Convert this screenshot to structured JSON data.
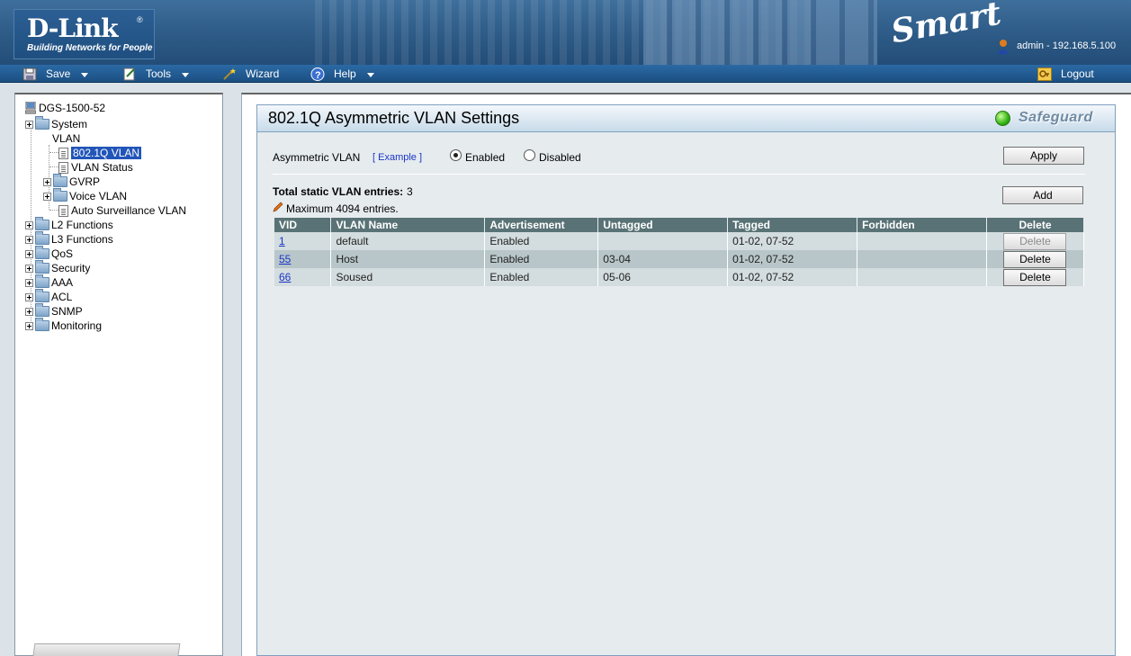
{
  "header": {
    "logo_text": "D-Link",
    "logo_registered": "®",
    "logo_tagline": "Building Networks for People",
    "brand_script": "Smart",
    "user_info": "admin - 192.168.5.100"
  },
  "menubar": {
    "save": "Save",
    "tools": "Tools",
    "wizard": "Wizard",
    "help": "Help",
    "logout": "Logout"
  },
  "tree": {
    "root": "DGS-1500-52",
    "system": "System",
    "vlan": "VLAN",
    "vlan_8021q": "802.1Q VLAN",
    "vlan_status": "VLAN Status",
    "gvrp": "GVRP",
    "voice_vlan": "Voice VLAN",
    "auto_surveillance": "Auto Surveillance VLAN",
    "l2": "L2 Functions",
    "l3": "L3 Functions",
    "qos": "QoS",
    "security": "Security",
    "aaa": "AAA",
    "acl": "ACL",
    "snmp": "SNMP",
    "monitoring": "Monitoring"
  },
  "page": {
    "title": "802.1Q Asymmetric VLAN Settings",
    "safeguard": "Safeguard",
    "asym_label": "Asymmetric VLAN",
    "example_link": "[ Example ]",
    "enabled_label": "Enabled",
    "disabled_label": "Disabled",
    "asym_state": "Enabled",
    "apply_button": "Apply",
    "total_label": "Total static VLAN entries:",
    "total_value": "3",
    "max_note": "Maximum 4094 entries.",
    "add_button": "Add"
  },
  "table": {
    "headers": [
      "VID",
      "VLAN Name",
      "Advertisement",
      "Untagged",
      "Tagged",
      "Forbidden",
      "Delete"
    ],
    "rows": [
      {
        "vid": "1",
        "name": "default",
        "advertisement": "Enabled",
        "untagged": "",
        "tagged": "01-02, 07-52",
        "forbidden": "",
        "delete": "Delete",
        "delete_enabled": false
      },
      {
        "vid": "55",
        "name": "Host",
        "advertisement": "Enabled",
        "untagged": "03-04",
        "tagged": "01-02, 07-52",
        "forbidden": "",
        "delete": "Delete",
        "delete_enabled": true
      },
      {
        "vid": "66",
        "name": "Soused",
        "advertisement": "Enabled",
        "untagged": "05-06",
        "tagged": "01-02, 07-52",
        "forbidden": "",
        "delete": "Delete",
        "delete_enabled": true
      }
    ]
  },
  "colors": {
    "header_blue": "#2d5a86",
    "table_header": "#597275",
    "row_light": "#d3dcde",
    "row_dark": "#b8c6c9",
    "selection": "#2255b8",
    "link": "#1a35c8"
  }
}
